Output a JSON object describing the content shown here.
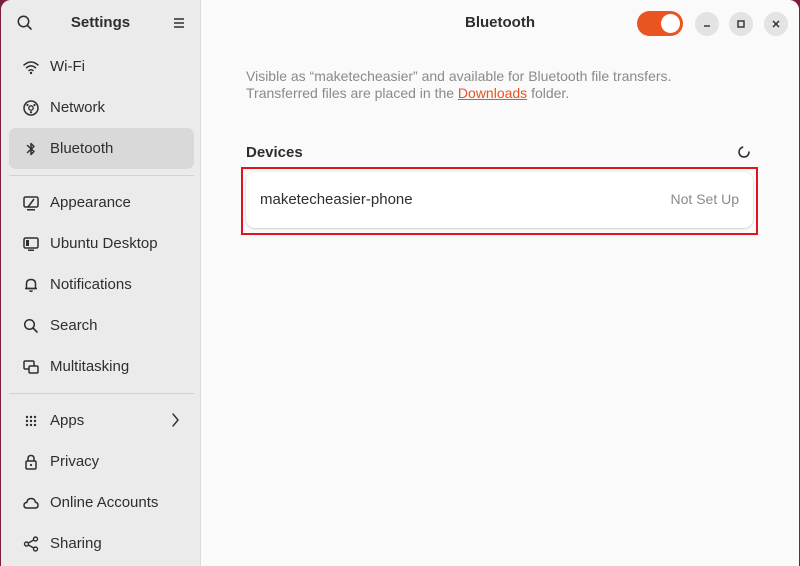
{
  "sidebar": {
    "title": "Settings",
    "group1": [
      {
        "label": "Wi-Fi",
        "icon": "wifi-icon"
      },
      {
        "label": "Network",
        "icon": "network-icon"
      },
      {
        "label": "Bluetooth",
        "icon": "bluetooth-icon",
        "active": true
      }
    ],
    "group2": [
      {
        "label": "Appearance",
        "icon": "appearance-icon"
      },
      {
        "label": "Ubuntu Desktop",
        "icon": "ubuntu-desktop-icon"
      },
      {
        "label": "Notifications",
        "icon": "bell-icon"
      },
      {
        "label": "Search",
        "icon": "search-icon"
      },
      {
        "label": "Multitasking",
        "icon": "multitasking-icon"
      }
    ],
    "group3": [
      {
        "label": "Apps",
        "icon": "apps-grid-icon",
        "chevron": true
      },
      {
        "label": "Privacy",
        "icon": "lock-icon"
      },
      {
        "label": "Online Accounts",
        "icon": "cloud-icon"
      },
      {
        "label": "Sharing",
        "icon": "share-icon"
      }
    ]
  },
  "main": {
    "title": "Bluetooth",
    "toggle_on": true,
    "info_line1": "Visible as “maketecheasier” and available for Bluetooth file transfers.",
    "info_line2_pre": "Transferred files are placed in the ",
    "info_link": "Downloads",
    "info_line2_post": " folder.",
    "devices_heading": "Devices",
    "devices": [
      {
        "name": "maketecheasier-phone",
        "status": "Not Set Up"
      }
    ]
  },
  "colors": {
    "accent": "#e95420",
    "highlight": "#e0141e"
  }
}
